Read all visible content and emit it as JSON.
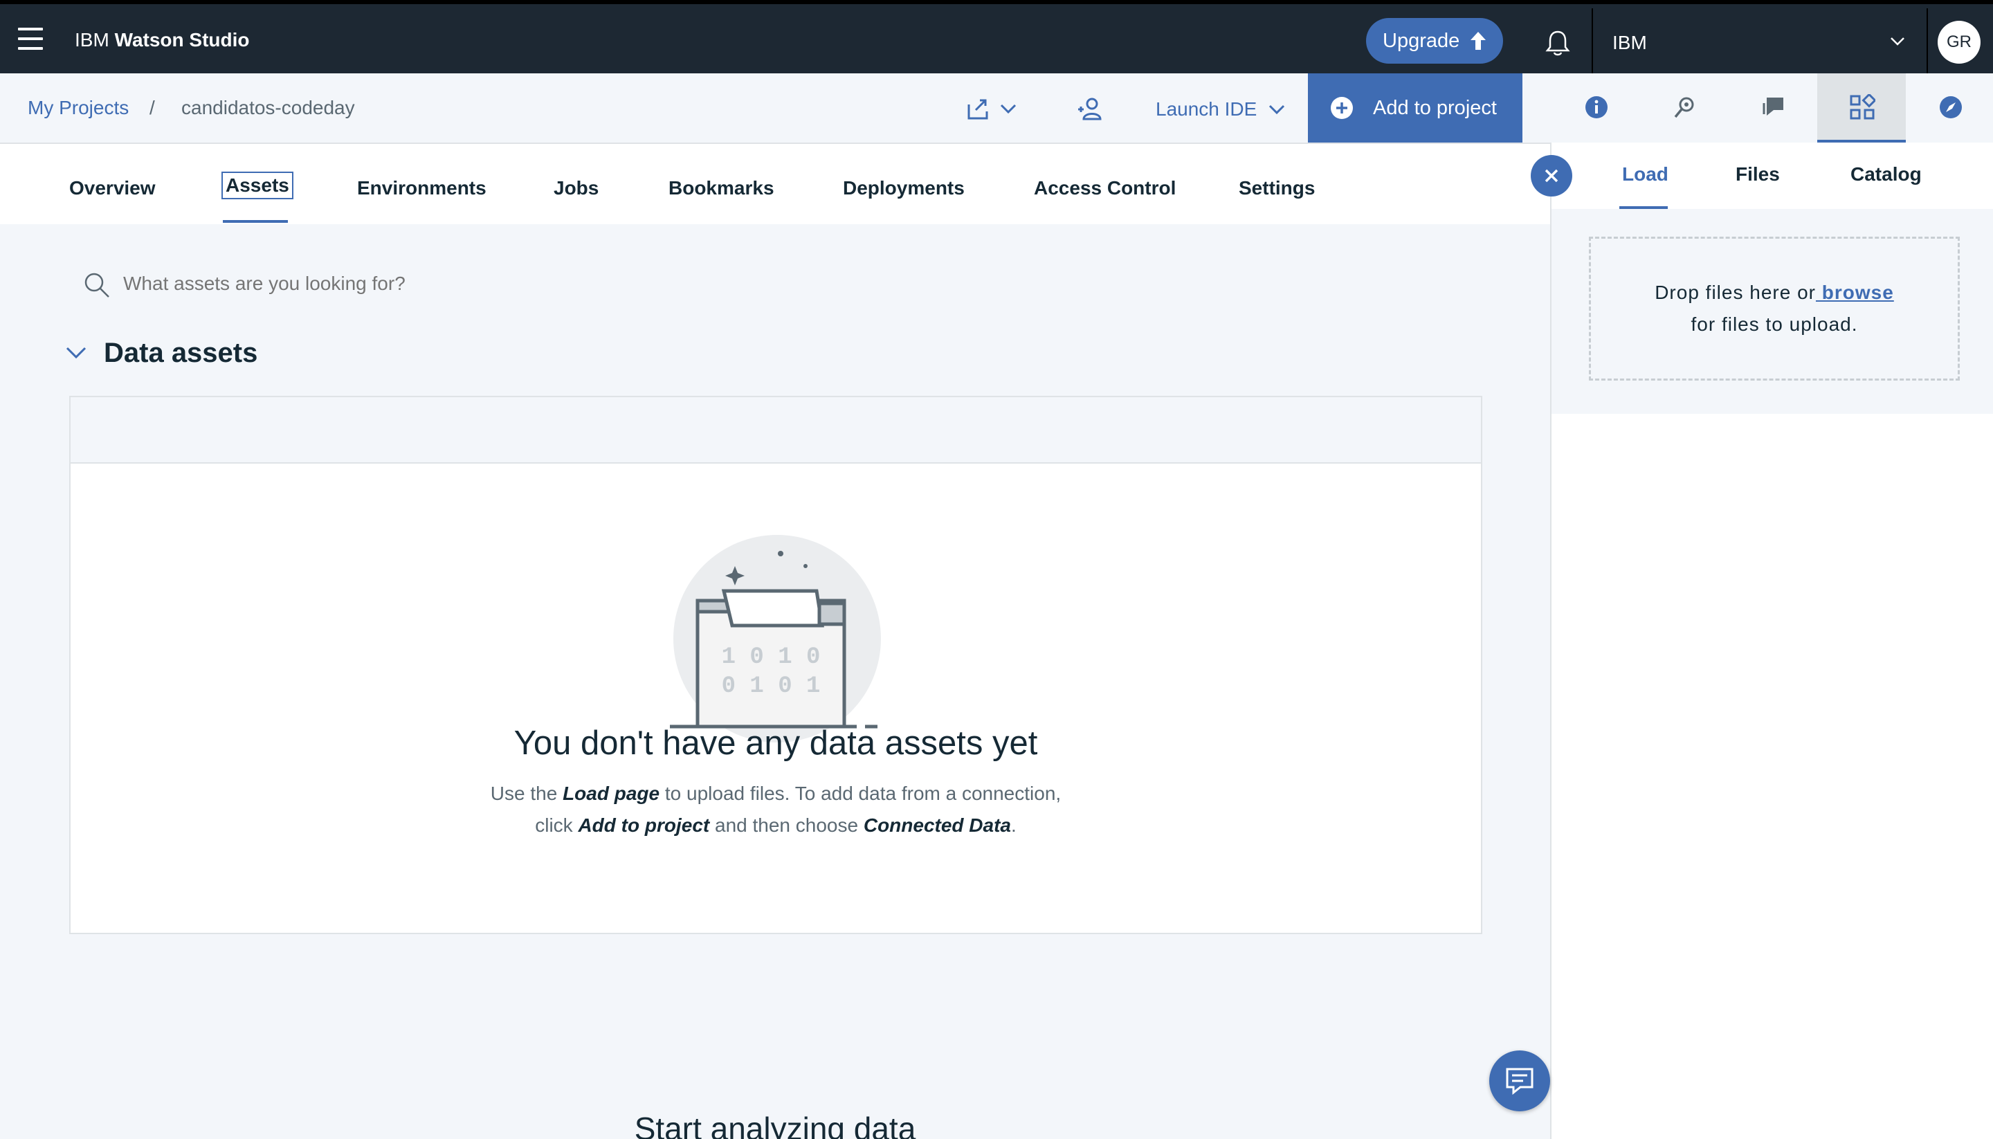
{
  "topbar": {
    "brand_prefix": "IBM",
    "brand_name": "Watson Studio",
    "upgrade_label": "Upgrade",
    "account_name": "IBM",
    "avatar_initials": "GR",
    "icons": [
      "menu-icon",
      "arrow-up-icon",
      "bell-icon",
      "chevron-down-icon"
    ]
  },
  "breadcrumb": {
    "root": "My Projects",
    "separator": "/",
    "project": "candidatos-codeday"
  },
  "project_actions": {
    "launch_ide": "Launch IDE",
    "add_to_project": "Add to project"
  },
  "tabs": [
    "Overview",
    "Assets",
    "Environments",
    "Jobs",
    "Bookmarks",
    "Deployments",
    "Access Control",
    "Settings"
  ],
  "active_tab": "Assets",
  "search": {
    "placeholder": "What assets are you looking for?"
  },
  "data_assets": {
    "title": "Data assets",
    "empty_title": "You don't have any data assets yet",
    "illus_row1": "1 0 1 0",
    "illus_row2": "0 1 0 1",
    "desc_part1": "Use the ",
    "desc_bold1": "Load page",
    "desc_part2": " to upload files. To add data from a connection,",
    "desc_part3": "click ",
    "desc_bold2": "Add to project",
    "desc_part4": " and then choose ",
    "desc_bold3": "Connected Data",
    "desc_part5": "."
  },
  "next_section_title": "Start analyzing data",
  "right_panel": {
    "tabs": [
      "Load",
      "Files",
      "Catalog"
    ],
    "active_tab": "Load",
    "drop_text": "Drop files here or",
    "browse_link": " browse",
    "drop_text2": "for files to upload.",
    "toolbar_icons": [
      "info-icon",
      "search-settings-icon",
      "chat-history-icon",
      "data-grid-icon",
      "compass-icon"
    ]
  },
  "colors": {
    "topbar_bg": "#1d2833",
    "accent": "#3f6cb3",
    "page_bg": "#f3f6fa",
    "text": "#152935"
  }
}
